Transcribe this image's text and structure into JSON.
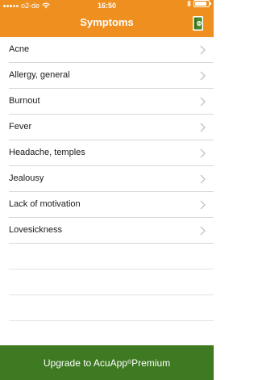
{
  "status_bar": {
    "carrier": "o2-de",
    "time": "16:50",
    "battery_level": 0.9
  },
  "header": {
    "title": "Symptoms",
    "background_color": "#ef8f1f",
    "book_icon": "book-icon"
  },
  "symptoms": [
    {
      "label": "Acne"
    },
    {
      "label": "Allergy, general"
    },
    {
      "label": "Burnout"
    },
    {
      "label": "Fever"
    },
    {
      "label": "Headache, temples"
    },
    {
      "label": "Jealousy"
    },
    {
      "label": "Lack of motivation"
    },
    {
      "label": "Lovesickness"
    }
  ],
  "premium_banner": {
    "label_before": "Upgrade to AcuApp",
    "registered": "®",
    "label_after": " Premium",
    "background_color": "#3e7a22"
  }
}
